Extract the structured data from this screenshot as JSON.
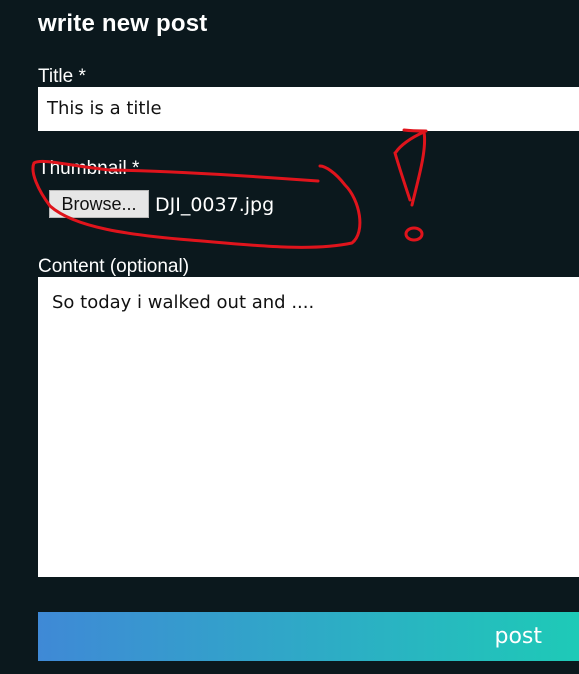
{
  "form": {
    "heading": "write new post",
    "title_label": "Title *",
    "title_value": "This is a title",
    "thumbnail_label": "Thumbnail *",
    "browse_label": "Browse...",
    "file_name": "DJI_0037.jpg",
    "content_label": "Content (optional)",
    "content_value": "So today i walked out and ....",
    "post_label": "post"
  },
  "colors": {
    "background": "#0b181d",
    "annotation": "#e0141c",
    "button_gradient_start": "#3f89d6",
    "button_gradient_end": "#1ecab7"
  }
}
